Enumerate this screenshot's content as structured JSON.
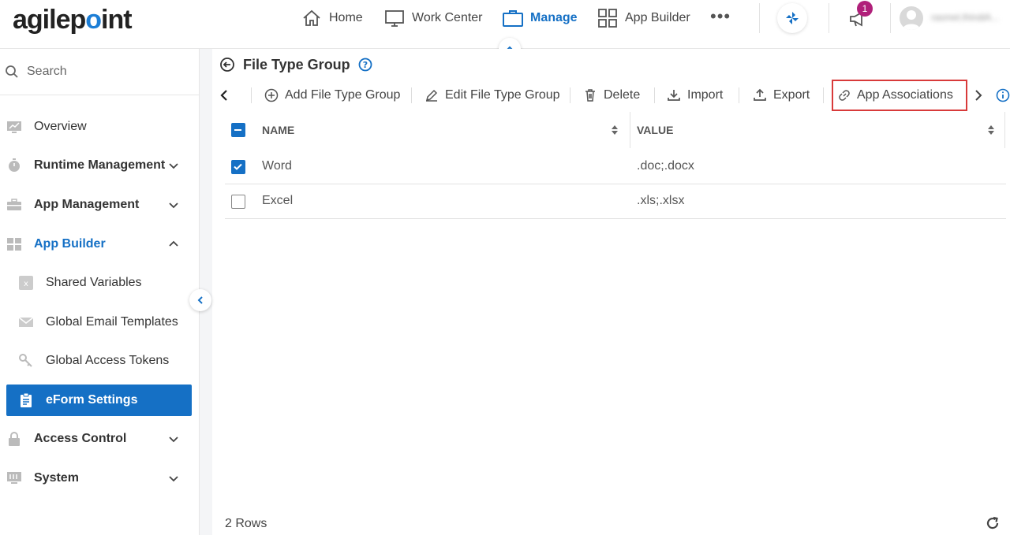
{
  "brand": {
    "logo_text_a": "agilep",
    "logo_text_b": "int"
  },
  "nav": {
    "home": "Home",
    "work_center": "Work Center",
    "manage": "Manage",
    "app_builder": "App Builder",
    "more": "•••",
    "notifications_count": "1",
    "username": "rasmet.lhindiA..."
  },
  "sidebar": {
    "search_placeholder": "Search",
    "items": [
      {
        "label": "Overview"
      },
      {
        "label": "Runtime Management"
      },
      {
        "label": "App Management"
      },
      {
        "label": "App Builder"
      },
      {
        "label": "Shared Variables"
      },
      {
        "label": "Global Email Templates"
      },
      {
        "label": "Global Access Tokens"
      },
      {
        "label": "eForm Settings"
      },
      {
        "label": "Access Control"
      },
      {
        "label": "System"
      }
    ]
  },
  "page": {
    "title": "File Type Group"
  },
  "toolbar": {
    "add": "Add File Type Group",
    "edit": "Edit File Type Group",
    "delete": "Delete",
    "import": "Import",
    "export": "Export",
    "app_associations": "App Associations"
  },
  "table": {
    "columns": [
      "NAME",
      "VALUE"
    ],
    "rows": [
      {
        "name": "Word",
        "value": ".doc;.docx",
        "checked": true
      },
      {
        "name": "Excel",
        "value": ".xls;.xlsx",
        "checked": false
      }
    ],
    "footer": "2 Rows"
  },
  "colors": {
    "accent": "#1570c5",
    "highlight": "#d83a3a",
    "badge": "#b0207a"
  }
}
